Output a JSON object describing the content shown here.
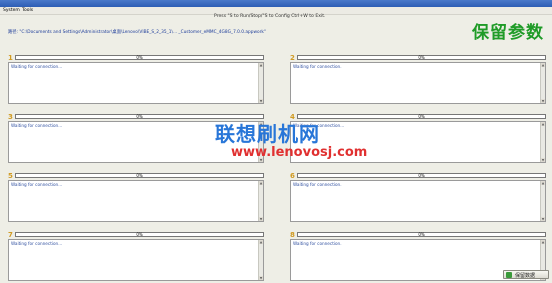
{
  "window": {
    "title": ""
  },
  "menu": {
    "items": [
      "System",
      "Tools"
    ]
  },
  "hint": "Press \"S to Run/Stop/\"S to Config Ctrl+W to Exit.",
  "path": "路径: \"C:\\Documents and Settings\\Administrator\\桌面\\Lenovo\\VIBE_S_2_35_1\\... _Customer_eMMC_4G8G_7.0.0.appwork\"",
  "watermarks": {
    "top": "保留参数",
    "middle": "联想刷机网",
    "url": "www.lenovosj.com"
  },
  "panels": [
    {
      "number": "1",
      "progress_text": "0%",
      "progress": 0,
      "log": "Waiting for connection..."
    },
    {
      "number": "2",
      "progress_text": "0%",
      "progress": 0,
      "log": "Waiting for connection."
    },
    {
      "number": "3",
      "progress_text": "0%",
      "progress": 0,
      "log": "Waiting for connection..."
    },
    {
      "number": "4",
      "progress_text": "0%",
      "progress": 0,
      "log": "Waiting for connection..."
    },
    {
      "number": "5",
      "progress_text": "0%",
      "progress": 0,
      "log": "Waiting for connection..."
    },
    {
      "number": "6",
      "progress_text": "0%",
      "progress": 0,
      "log": "Waiting for connection."
    },
    {
      "number": "7",
      "progress_text": "0%",
      "progress": 0,
      "log": "Waiting for connection..."
    },
    {
      "number": "8",
      "progress_text": "0%",
      "progress": 0,
      "log": "Waiting for connection."
    }
  ],
  "save_button": {
    "label": "保留数据"
  }
}
